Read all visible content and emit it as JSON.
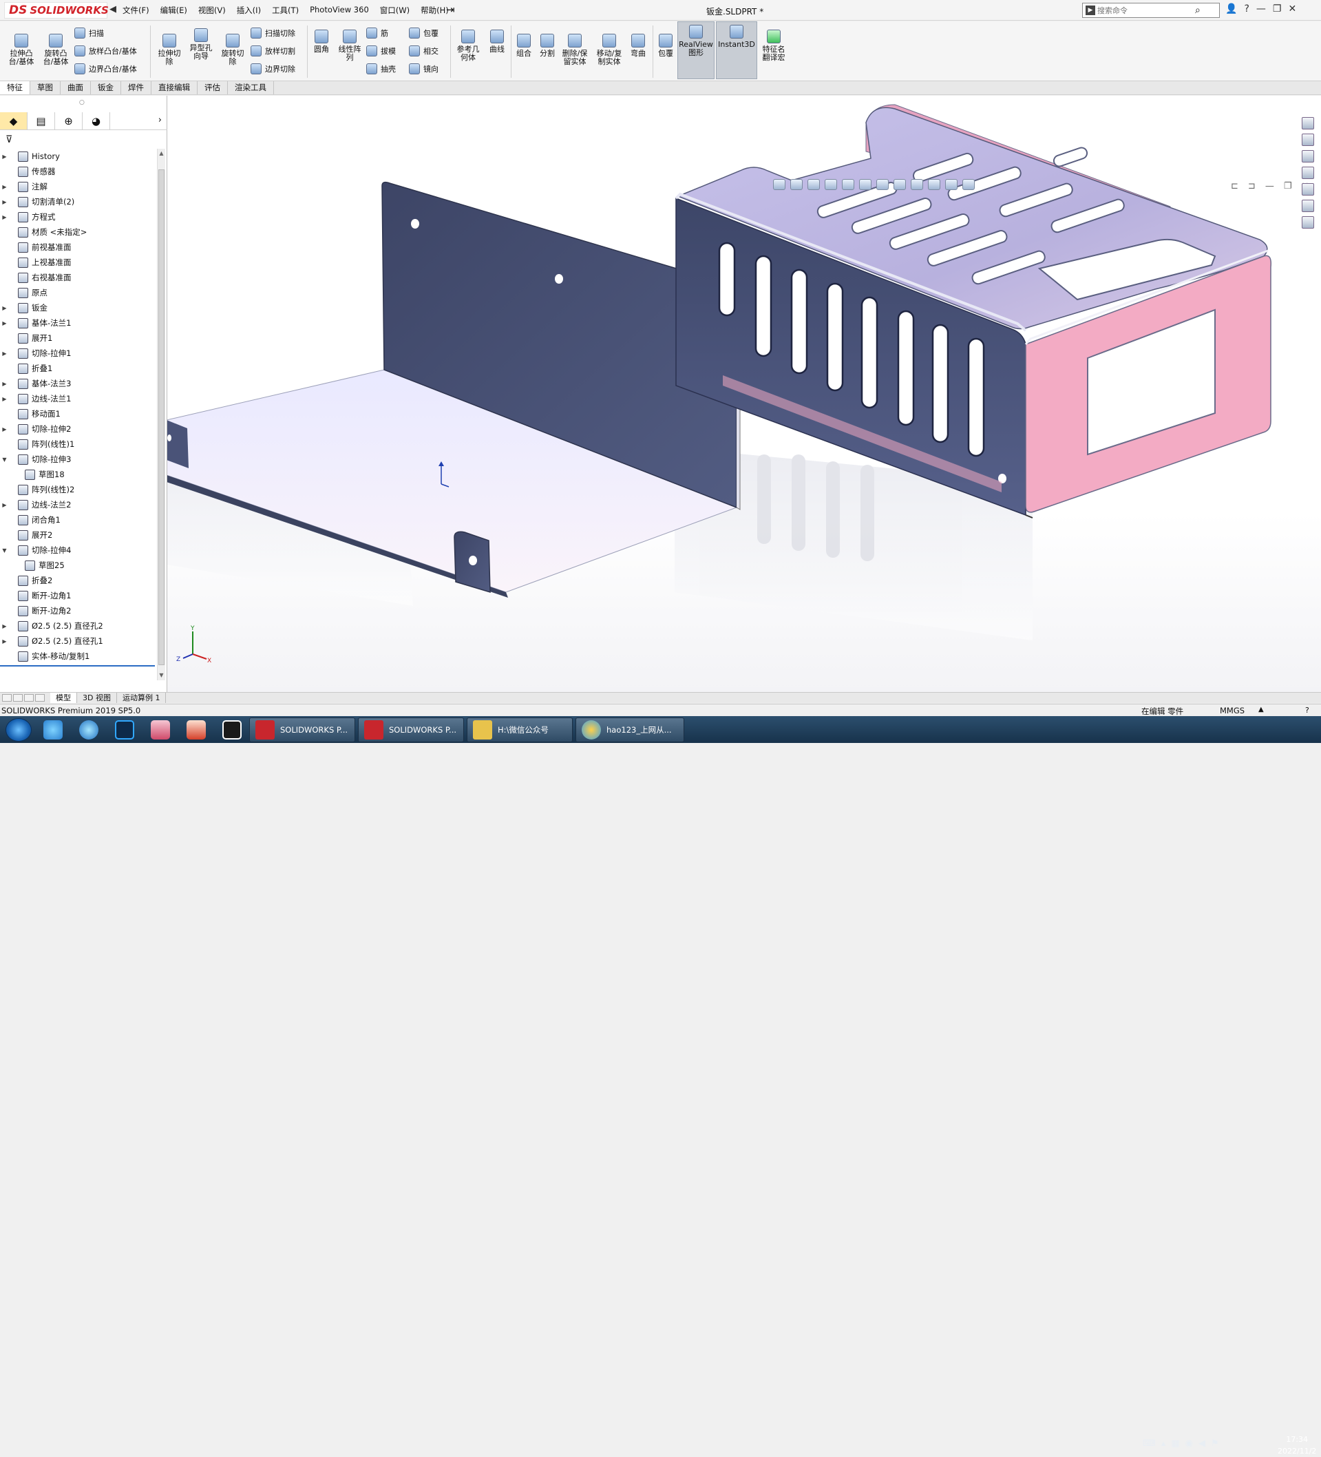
{
  "app": {
    "brand": "SOLIDWORKS",
    "brand_mark": "DS",
    "doc_title": "钣金.SLDPRT *"
  },
  "menu": [
    "文件(F)",
    "编辑(E)",
    "视图(V)",
    "插入(I)",
    "工具(T)",
    "PhotoView 360",
    "窗口(W)",
    "帮助(H)"
  ],
  "search": {
    "placeholder": "搜索命令"
  },
  "ribbon": {
    "extrude_boss": "拉伸凸\n台/基体",
    "revolve_boss": "旋转凸\n台/基体",
    "sweep": "扫描",
    "loft_boss": "放样凸台/基体",
    "boundary_boss": "边界凸台/基体",
    "extrude_cut": "拉伸切\n除",
    "hole_wizard": "异型孔\n向导",
    "revolve_cut": "旋转切\n除",
    "sweep_cut": "扫描切除",
    "loft_cut": "放样切割",
    "boundary_cut": "边界切除",
    "fillet": "圆角",
    "linear_pattern": "线性阵\n列",
    "rib": "筋",
    "draft": "拔模",
    "shell": "抽壳",
    "wrap": "包覆",
    "intersect": "相交",
    "mirror": "镜向",
    "ref_geometry": "参考几\n何体",
    "curves": "曲线",
    "combine": "组合",
    "split": "分割",
    "delete_keep_body": "删除/保\n留实体",
    "move_copy_body": "移动/复\n制实体",
    "flex": "弯曲",
    "indent": "包覆",
    "realview": "RealView\n图形",
    "instant3d": "Instant3D",
    "feature_translate": "特征名\n翻译宏"
  },
  "tabs": [
    "特征",
    "草图",
    "曲面",
    "钣金",
    "焊件",
    "直接编辑",
    "评估",
    "渲染工具"
  ],
  "tree": [
    {
      "label": "History",
      "expand": true,
      "icon": "history-icon"
    },
    {
      "label": "传感器",
      "expand": false,
      "icon": "sensor-icon"
    },
    {
      "label": "注解",
      "expand": true,
      "icon": "annotation-icon"
    },
    {
      "label": "切割清单(2)",
      "expand": true,
      "icon": "cut-list-icon"
    },
    {
      "label": "方程式",
      "expand": true,
      "icon": "equation-icon"
    },
    {
      "label": "材质 <未指定>",
      "expand": false,
      "icon": "material-icon"
    },
    {
      "label": "前视基准面",
      "expand": false,
      "icon": "plane-icon"
    },
    {
      "label": "上视基准面",
      "expand": false,
      "icon": "plane-icon"
    },
    {
      "label": "右视基准面",
      "expand": false,
      "icon": "plane-icon"
    },
    {
      "label": "原点",
      "expand": false,
      "icon": "origin-icon"
    },
    {
      "label": "钣金",
      "expand": true,
      "icon": "sheet-metal-icon"
    },
    {
      "label": "基体-法兰1",
      "expand": true,
      "icon": "base-flange-icon"
    },
    {
      "label": "展开1",
      "expand": false,
      "icon": "unfold-icon"
    },
    {
      "label": "切除-拉伸1",
      "expand": true,
      "icon": "cut-extrude-icon"
    },
    {
      "label": "折叠1",
      "expand": false,
      "icon": "fold-icon"
    },
    {
      "label": "基体-法兰3",
      "expand": true,
      "icon": "base-flange-icon"
    },
    {
      "label": "边线-法兰1",
      "expand": true,
      "icon": "edge-flange-icon"
    },
    {
      "label": "移动面1",
      "expand": false,
      "icon": "move-face-icon"
    },
    {
      "label": "切除-拉伸2",
      "expand": true,
      "icon": "cut-extrude-icon"
    },
    {
      "label": "阵列(线性)1",
      "expand": false,
      "icon": "linear-pattern-icon"
    },
    {
      "label": "切除-拉伸3",
      "expand": "open",
      "icon": "cut-extrude-icon"
    },
    {
      "label": "草图18",
      "expand": false,
      "icon": "sketch-icon",
      "indent": 1
    },
    {
      "label": "阵列(线性)2",
      "expand": false,
      "icon": "linear-pattern-icon"
    },
    {
      "label": "边线-法兰2",
      "expand": true,
      "icon": "edge-flange-icon"
    },
    {
      "label": "闭合角1",
      "expand": false,
      "icon": "closed-corner-icon"
    },
    {
      "label": "展开2",
      "expand": false,
      "icon": "unfold-icon"
    },
    {
      "label": "切除-拉伸4",
      "expand": "open",
      "icon": "cut-extrude-icon"
    },
    {
      "label": "草图25",
      "expand": false,
      "icon": "sketch-icon",
      "indent": 1
    },
    {
      "label": "折叠2",
      "expand": false,
      "icon": "fold-icon"
    },
    {
      "label": "断开-边角1",
      "expand": false,
      "icon": "break-corner-icon"
    },
    {
      "label": "断开-边角2",
      "expand": false,
      "icon": "break-corner-icon"
    },
    {
      "label": "Ø2.5 (2.5) 直径孔2",
      "expand": true,
      "icon": "hole-icon"
    },
    {
      "label": "Ø2.5 (2.5) 直径孔1",
      "expand": true,
      "icon": "hole-icon"
    },
    {
      "label": "实体-移动/复制1",
      "expand": false,
      "icon": "move-copy-body-icon"
    },
    {
      "label": "平板型式",
      "expand": false,
      "icon": "flat-pattern-icon",
      "grey": true
    }
  ],
  "bottom_tabs": [
    "模型",
    "3D 视图",
    "运动算例 1"
  ],
  "status": {
    "product": "SOLIDWORKS Premium 2019 SP5.0",
    "editing": "在编辑 零件",
    "units": "MMGS",
    "units_arrow": "▲",
    "help": "?"
  },
  "taskbar": {
    "items": [
      {
        "label": "SOLIDWORKS P...",
        "badge": "2019",
        "color": "#c8262d"
      },
      {
        "label": "SOLIDWORKS P...",
        "badge": "2019",
        "color": "#c8262d"
      },
      {
        "label": "H:\\微信公众号",
        "color": "#e8c34c"
      },
      {
        "label": "hao123_上网从...",
        "color": "#3fa0e0"
      }
    ],
    "time": "17:34",
    "date": "2022/11/2"
  },
  "triad": {
    "y": "Y",
    "z": "Z",
    "x": "X"
  },
  "colors": {
    "accent": "#2b6cc4",
    "flange_dark": "#4a5478",
    "pink_face": "#f3a9c2",
    "taskbar": "#1f3d5a"
  }
}
